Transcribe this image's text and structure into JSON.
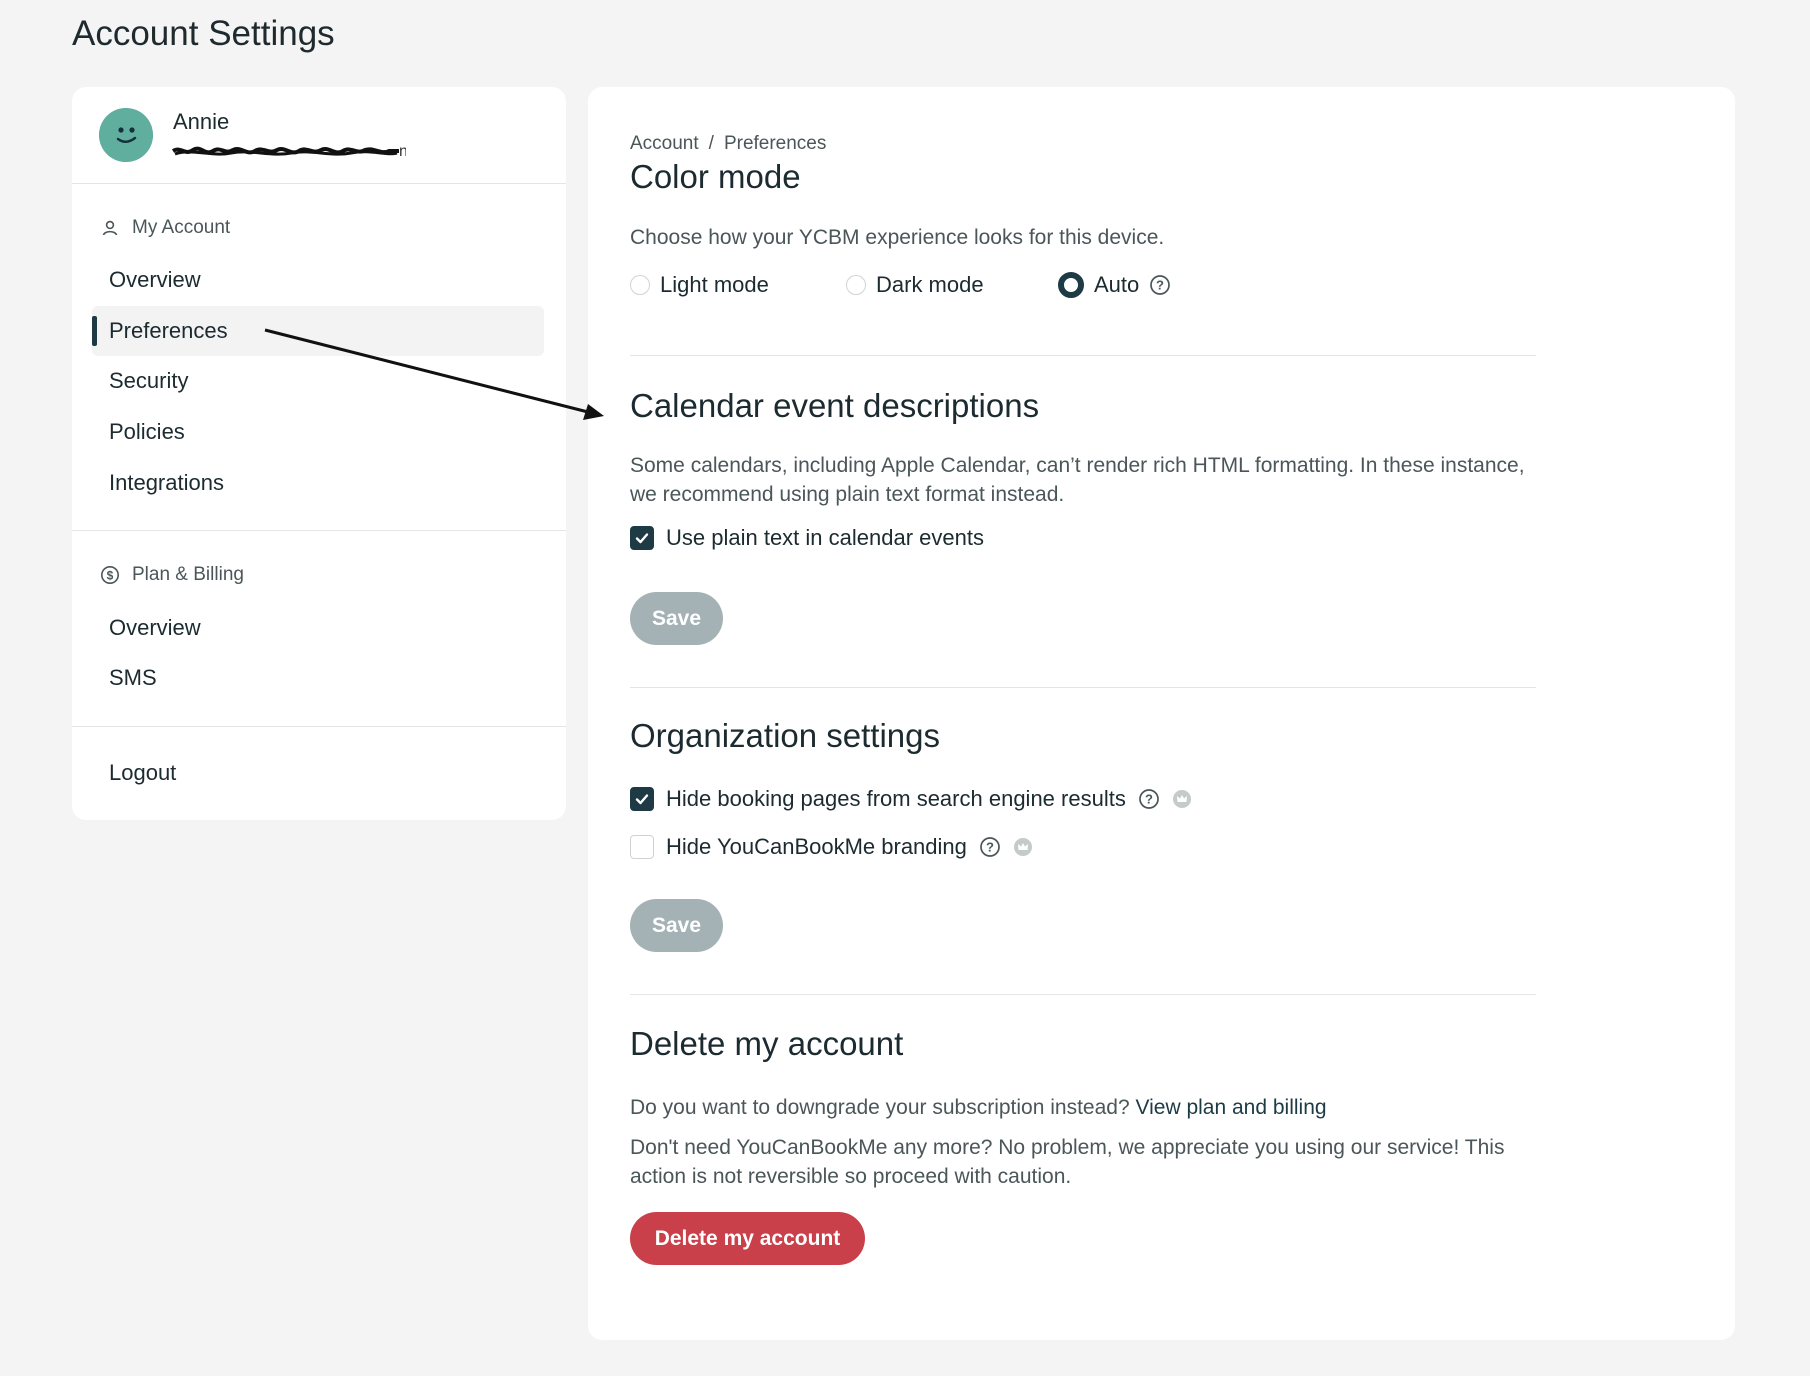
{
  "page": {
    "title": "Account Settings"
  },
  "profile": {
    "name": "Annie"
  },
  "sidebar": {
    "sections": [
      {
        "label": "My Account",
        "icon": "user-icon",
        "items": [
          "Overview",
          "Preferences",
          "Security",
          "Policies",
          "Integrations"
        ],
        "active_index": 1
      },
      {
        "label": "Plan & Billing",
        "icon": "dollar-icon",
        "items": [
          "Overview",
          "SMS"
        ]
      }
    ],
    "logout": "Logout"
  },
  "breadcrumb": {
    "parent": "Account",
    "separator": "/",
    "current": "Preferences"
  },
  "color_mode": {
    "title": "Color mode",
    "description": "Choose how your YCBM experience looks for this device.",
    "options": [
      {
        "label": "Light mode",
        "selected": false
      },
      {
        "label": "Dark mode",
        "selected": false
      },
      {
        "label": "Auto",
        "selected": true
      }
    ]
  },
  "calendar": {
    "title": "Calendar event descriptions",
    "description": "Some calendars, including Apple Calendar, can’t render rich HTML formatting. In these instance, we recommend using plain text format instead.",
    "checkbox_label": "Use plain text in calendar events",
    "checked": true,
    "save_label": "Save"
  },
  "organization": {
    "title": "Organization settings",
    "options": [
      {
        "label": "Hide booking pages from search engine results",
        "checked": true
      },
      {
        "label": "Hide YouCanBookMe branding",
        "checked": false
      }
    ],
    "save_label": "Save"
  },
  "delete_account": {
    "title": "Delete my account",
    "downgrade_prompt": "Do you want to downgrade your subscription instead?",
    "downgrade_link": "View plan and billing",
    "warning": "Don't need YouCanBookMe any more? No problem, we appreciate you using our service! This action is not reversible so proceed with caution.",
    "button_label": "Delete my account"
  },
  "colors": {
    "accent": "#1d3a45",
    "disabled_button": "#a4b2b5",
    "danger": "#c9404a",
    "avatar": "#5fae9e"
  }
}
